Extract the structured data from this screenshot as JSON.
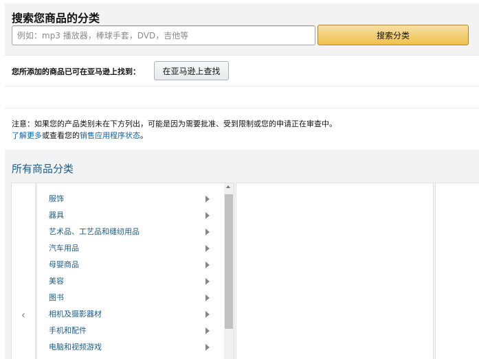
{
  "search": {
    "title": "搜索您商品的分类",
    "placeholder": "例如：mp3 播放器，棒球手套，DVD，吉他等",
    "button_label": "搜索分类"
  },
  "find_on_amazon": {
    "label": "您所添加的商品已可在亚马逊上找到：",
    "button_label": "在亚马逊上查找"
  },
  "notice": {
    "text": "注意：如果您的产品类别未在下方列出，可能是因为需要批准、受到限制或您的申请正在审查中。",
    "learn_more": "了解更多",
    "or_view": "或查看您的",
    "status_link": "销售应用程序状态",
    "period": "。"
  },
  "categories": {
    "heading": "所有商品分类",
    "items": [
      "服饰",
      "器具",
      "艺术品、工艺品和缝纫用品",
      "汽车用品",
      "母婴商品",
      "美容",
      "图书",
      "相机及摄影器材",
      "手机和配件",
      "电脑和视频游戏"
    ]
  },
  "colors": {
    "link": "#0066c0",
    "category_text": "#1a5d8a",
    "search_button": "#f0c14b",
    "panel_bg": "#f3f3f3"
  }
}
